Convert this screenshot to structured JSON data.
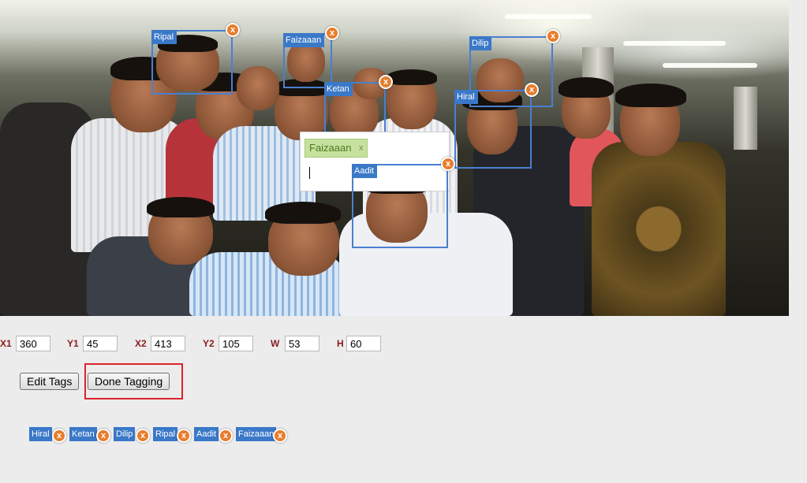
{
  "photo": {
    "alt": "",
    "tags": [
      {
        "name": "Ripal"
      },
      {
        "name": "Faizaaan"
      },
      {
        "name": "Dilip"
      },
      {
        "name": "Ketan"
      },
      {
        "name": "Hiral"
      },
      {
        "name": "Aadit"
      }
    ],
    "remove_glyph": "x"
  },
  "popup": {
    "chip_label": "Faizaaan",
    "chip_remove": "x",
    "input_value": ""
  },
  "coords": {
    "x1": {
      "label": "X1",
      "value": "360"
    },
    "y1": {
      "label": "Y1",
      "value": "45"
    },
    "x2": {
      "label": "X2",
      "value": "413"
    },
    "y2": {
      "label": "Y2",
      "value": "105"
    },
    "w": {
      "label": "W",
      "value": "53"
    },
    "h": {
      "label": "H",
      "value": "60"
    }
  },
  "buttons": {
    "edit_tags": "Edit Tags",
    "done_tagging": "Done Tagging"
  },
  "tag_list": [
    {
      "name": "Hiral"
    },
    {
      "name": "Ketan"
    },
    {
      "name": "Dilip"
    },
    {
      "name": "Ripal"
    },
    {
      "name": "Aadit"
    },
    {
      "name": "Faizaaan"
    }
  ],
  "colors": {
    "tag_blue": "#3a78c8",
    "remove_orange": "#e87d2d",
    "highlight_red": "#d9242b",
    "label_red": "#8b1e1e"
  }
}
